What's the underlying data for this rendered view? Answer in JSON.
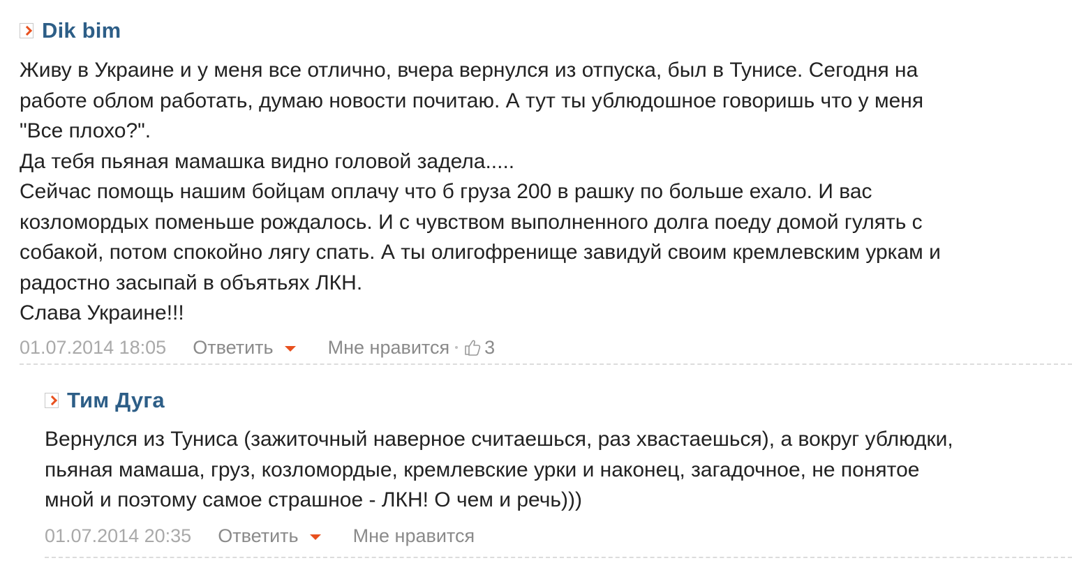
{
  "comments": [
    {
      "author": "Dik bim",
      "lines": [
        "Живу в Украине и у меня все отлично, вчера вернулся из отпуска, был в Тунисе. Сегодня на",
        "работе облом работать, думаю новости почитаю. А тут ты ублюдошное говоришь что у меня",
        "\"Все плохо?\".",
        "Да тебя пьяная мамашка видно головой задела.....",
        "Сейчас помощь нашим бойцам оплачу что б груза 200 в рашку по больше ехало. И вас",
        "козломордых поменьше рождалось. И с чувством выполненного долга поеду домой гулять с",
        "собакой, потом спокойно лягу спать. А ты олигофренище завидуй своим кремлевским уркам и",
        "радостно засыпай в объятьях ЛКН.",
        "Слава Украине!!!"
      ],
      "date": "01.07.2014 18:05",
      "reply_label": "Ответить",
      "like_label": "Мне нравится",
      "likes": "3"
    },
    {
      "author": "Тим Дуга",
      "lines": [
        "Вернулся из Туниса (зажиточный наверное считаешься, раз хвастаешься), а вокруг ублюдки,",
        "пьяная мамаша, груз, козломордые, кремлевские урки и наконец, загадочное, не понятое",
        "мной и поэтому самое страшное - ЛКН! О чем и речь)))"
      ],
      "date": "01.07.2014 20:35",
      "reply_label": "Ответить",
      "like_label": "Мне нравится"
    }
  ],
  "colors": {
    "author": "#2d5e87",
    "accent": "#e8501e",
    "meta": "#a9a9a9",
    "text": "#222222"
  },
  "icons": [
    "author-marker-icon",
    "dropdown-caret-icon",
    "thumbs-up-icon"
  ]
}
